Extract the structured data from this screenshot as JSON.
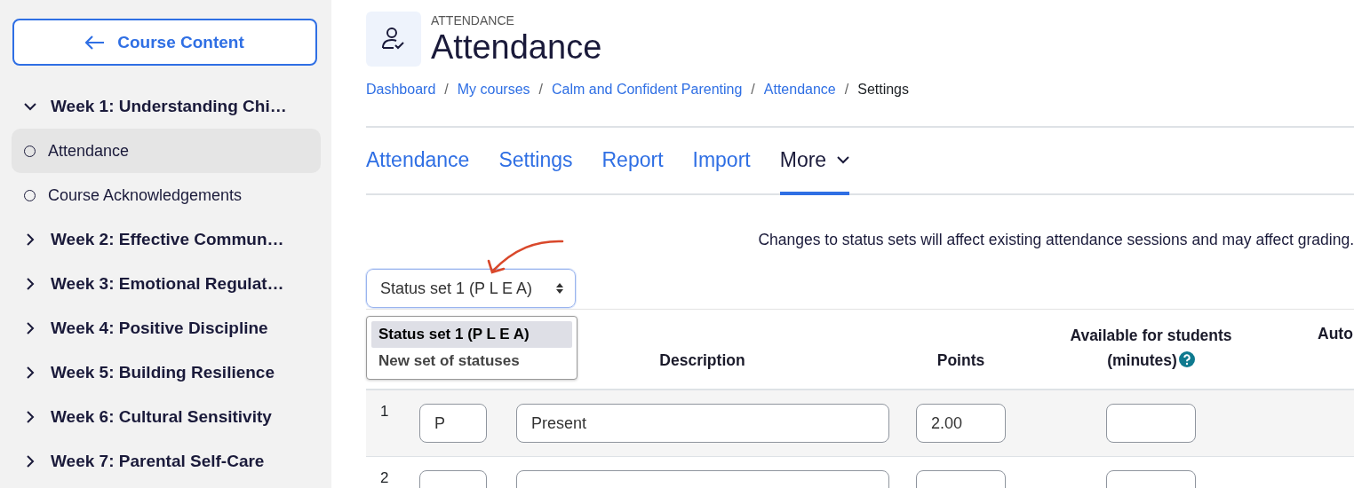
{
  "sidebar": {
    "back_button": {
      "label": "Course Content"
    },
    "sections": [
      {
        "title": "Week 1: Understanding Chi…",
        "expanded": true,
        "children": [
          {
            "label": "Attendance",
            "selected": true
          },
          {
            "label": "Course Acknowledgements",
            "selected": false
          }
        ]
      },
      {
        "title": "Week 2: Effective Commun…",
        "expanded": false
      },
      {
        "title": "Week 3: Emotional Regulat…",
        "expanded": false
      },
      {
        "title": "Week 4: Positive Discipline",
        "expanded": false
      },
      {
        "title": "Week 5: Building Resilience",
        "expanded": false
      },
      {
        "title": "Week 6: Cultural Sensitivity",
        "expanded": false
      },
      {
        "title": "Week 7: Parental Self-Care",
        "expanded": false
      }
    ]
  },
  "header": {
    "module_label": "ATTENDANCE",
    "title": "Attendance"
  },
  "breadcrumb": [
    {
      "label": "Dashboard",
      "kind": "link",
      "separator_after": "/"
    },
    {
      "label": "My courses",
      "kind": "link",
      "separator_after": "/"
    },
    {
      "label": "Calm and Confident Parenting",
      "kind": "link",
      "separator_after": "/"
    },
    {
      "label": "Attendance",
      "kind": "link",
      "separator_after": "/"
    },
    {
      "label": "Settings",
      "kind": "current"
    }
  ],
  "tabs": [
    {
      "label": "Attendance",
      "selected": false,
      "kind": "link"
    },
    {
      "label": "Settings",
      "selected": false,
      "kind": "link"
    },
    {
      "label": "Report",
      "selected": false,
      "kind": "link"
    },
    {
      "label": "Import",
      "selected": false,
      "kind": "link"
    },
    {
      "label": "More",
      "selected": true,
      "kind": "menu"
    }
  ],
  "notice": "Changes to status sets will affect existing attendance sessions and may affect grading.",
  "status_set_select": {
    "value": "Status set 1 (P L E A)",
    "expanded": true,
    "options": [
      {
        "label": "Status set 1 (P L E A)",
        "selected": true
      },
      {
        "label": "New set of statuses",
        "selected": false
      }
    ]
  },
  "table": {
    "columns": [
      {
        "label": "Description",
        "help": false
      },
      {
        "label": "Points",
        "help": false
      },
      {
        "label": "Available for students (minutes)",
        "help": true
      },
      {
        "label": "Auto",
        "help": false
      }
    ],
    "rows": [
      {
        "number": "1",
        "acronym": "P",
        "description": "Present",
        "points": "2.00"
      },
      {
        "number": "2"
      }
    ]
  }
}
